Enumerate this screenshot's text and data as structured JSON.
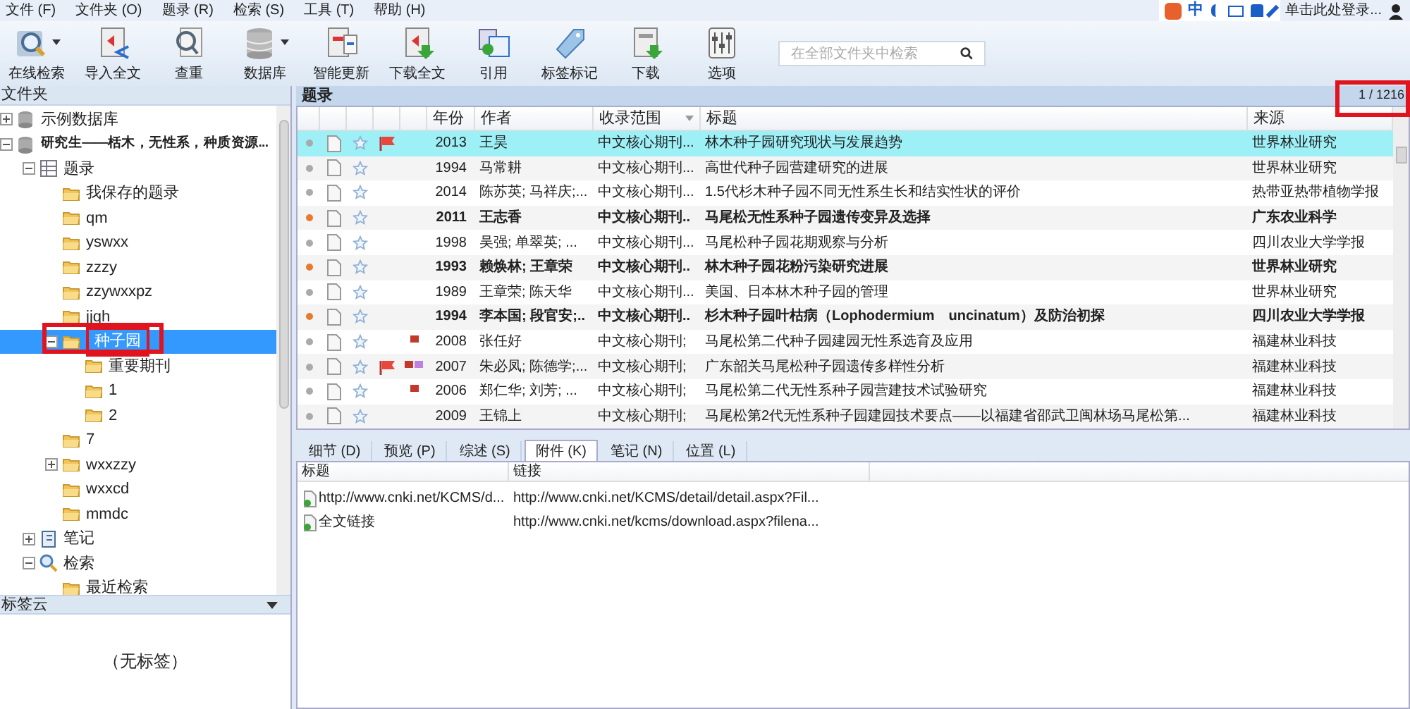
{
  "menu": [
    "文件 (F)",
    "文件夹 (O)",
    "题录 (R)",
    "检索 (S)",
    "工具 (T)",
    "帮助 (H)"
  ],
  "ime": {
    "label": "中",
    "login": "单击此处登录..."
  },
  "toolbar": [
    {
      "kind": "search",
      "label": "在线检索",
      "dropdown": true
    },
    {
      "kind": "import",
      "label": "导入全文",
      "dropdown": false
    },
    {
      "kind": "dedupe",
      "label": "查重",
      "dropdown": false
    },
    {
      "kind": "database",
      "label": "数据库",
      "dropdown": true
    },
    {
      "kind": "update",
      "label": "智能更新",
      "dropdown": false
    },
    {
      "kind": "download-full",
      "label": "下载全文",
      "dropdown": false
    },
    {
      "kind": "cite",
      "label": "引用",
      "dropdown": false
    },
    {
      "kind": "tag",
      "label": "标签标记",
      "dropdown": false
    },
    {
      "kind": "download",
      "label": "下载",
      "dropdown": false
    },
    {
      "kind": "options",
      "label": "选项",
      "dropdown": false
    }
  ],
  "search": {
    "placeholder": "在全部文件夹中检索"
  },
  "folders": {
    "title": "文件夹",
    "tree": [
      {
        "kind": "database",
        "label": "示例数据库",
        "bold": false,
        "expanded": false,
        "selected": false
      },
      {
        "kind": "database",
        "label": "研究生——栝木，无性系，种质资源...",
        "bold": true,
        "expanded": true,
        "selected": false,
        "children": [
          {
            "kind": "records",
            "label": "题录",
            "expanded": true,
            "selected": false,
            "children": [
              {
                "kind": "folder",
                "label": "我保存的题录",
                "selected": false
              },
              {
                "kind": "folder",
                "label": "qm",
                "selected": false
              },
              {
                "kind": "folder",
                "label": "yswxx",
                "selected": false
              },
              {
                "kind": "folder",
                "label": "zzzy",
                "selected": false
              },
              {
                "kind": "folder",
                "label": "zzywxxpz",
                "selected": false
              },
              {
                "kind": "folder",
                "label": "jjqh",
                "selected": false
              },
              {
                "kind": "folder",
                "label": "种子园",
                "expanded": true,
                "selected": true,
                "children": [
                  {
                    "kind": "folder",
                    "label": "重要期刊",
                    "selected": false
                  },
                  {
                    "kind": "folder",
                    "label": "1",
                    "selected": false
                  },
                  {
                    "kind": "folder",
                    "label": "2",
                    "selected": false
                  }
                ]
              },
              {
                "kind": "folder",
                "label": "7",
                "selected": false
              },
              {
                "kind": "folder",
                "label": "wxxzzy",
                "expanded": false,
                "selected": false
              },
              {
                "kind": "folder",
                "label": "wxxcd",
                "selected": false
              },
              {
                "kind": "folder",
                "label": "mmdc",
                "selected": false
              }
            ]
          },
          {
            "kind": "notes",
            "label": "笔记",
            "expanded": false,
            "selected": false
          },
          {
            "kind": "search",
            "label": "检索",
            "expanded": true,
            "selected": false,
            "children": [
              {
                "kind": "folder",
                "label": "最近检索",
                "selected": false
              }
            ]
          }
        ]
      }
    ]
  },
  "tag_cloud": {
    "title": "标签云",
    "empty": "（无标签）"
  },
  "records": {
    "title": "题录",
    "count": "1 / 1216",
    "columns": [
      "年份",
      "作者",
      "收录范围",
      "标题",
      "来源"
    ],
    "rows": [
      {
        "selected": true,
        "unread": false,
        "flagged": true,
        "tags": [],
        "year": "2013",
        "author": "王昊",
        "scope": "中文核心期刊...",
        "title": "林木种子园研究现状与发展趋势",
        "source": "世界林业研究"
      },
      {
        "selected": false,
        "unread": false,
        "flagged": false,
        "tags": [],
        "year": "1994",
        "author": "马常耕",
        "scope": "中文核心期刊...",
        "title": "高世代种子园营建研究的进展",
        "source": "世界林业研究"
      },
      {
        "selected": false,
        "unread": false,
        "flagged": false,
        "tags": [],
        "year": "2014",
        "author": "陈苏英; 马祥庆;...",
        "scope": "中文核心期刊...",
        "title": "1.5代杉木种子园不同无性系生长和结实性状的评价",
        "source": "热带亚热带植物学报"
      },
      {
        "selected": false,
        "unread": true,
        "flagged": false,
        "tags": [],
        "year": "2011",
        "author": "王志香",
        "scope": "中文核心期刊..",
        "title": "马尾松无性系种子园遗传变异及选择",
        "source": "广东农业科学"
      },
      {
        "selected": false,
        "unread": false,
        "flagged": false,
        "tags": [],
        "year": "1998",
        "author": "吴强; 单翠英; ...",
        "scope": "中文核心期刊...",
        "title": "马尾松种子园花期观察与分析",
        "source": "四川农业大学学报"
      },
      {
        "selected": false,
        "unread": true,
        "flagged": false,
        "tags": [],
        "year": "1993",
        "author": "赖焕林; 王章荣",
        "scope": "中文核心期刊..",
        "title": "林木种子园花粉污染研究进展",
        "source": "世界林业研究"
      },
      {
        "selected": false,
        "unread": false,
        "flagged": false,
        "tags": [],
        "year": "1989",
        "author": "王章荣; 陈天华",
        "scope": "中文核心期刊...",
        "title": "美国、日本林木种子园的管理",
        "source": "世界林业研究"
      },
      {
        "selected": false,
        "unread": true,
        "flagged": false,
        "tags": [],
        "year": "1994",
        "author": "李本国; 段官安;..",
        "scope": "中文核心期刊..",
        "title": "杉木种子园叶枯病（Lophodermium　uncinatum）及防治初探",
        "source": "四川农业大学学报"
      },
      {
        "selected": false,
        "unread": false,
        "flagged": false,
        "tags": [
          {
            "color": "#c0392b"
          }
        ],
        "year": "2008",
        "author": "张任好",
        "scope": "中文核心期刊;",
        "title": "马尾松第二代种子园建园无性系选育及应用",
        "source": "福建林业科技"
      },
      {
        "selected": false,
        "unread": false,
        "flagged": true,
        "tags": [
          {
            "color": "#c0392b"
          },
          {
            "color": "#c080e0"
          }
        ],
        "year": "2007",
        "author": "朱必凤; 陈德学;...",
        "scope": "中文核心期刊;",
        "title": "广东韶关马尾松种子园遗传多样性分析",
        "source": "福建林业科技"
      },
      {
        "selected": false,
        "unread": false,
        "flagged": false,
        "tags": [
          {
            "color": "#c0392b"
          }
        ],
        "year": "2006",
        "author": "郑仁华; 刘芳; ...",
        "scope": "中文核心期刊;",
        "title": "马尾松第二代无性系种子园营建技术试验研究",
        "source": "福建林业科技"
      },
      {
        "selected": false,
        "unread": false,
        "flagged": false,
        "tags": [],
        "year": "2009",
        "author": "王锦上",
        "scope": "中文核心期刊;",
        "title": "马尾松第2代无性系种子园建园技术要点——以福建省邵武卫闽林场马尾松第...",
        "source": "福建林业科技"
      }
    ]
  },
  "detail_tabs": [
    {
      "label": "细节 (D)",
      "selected": false
    },
    {
      "label": "预览 (P)",
      "selected": false
    },
    {
      "label": "综述 (S)",
      "selected": false
    },
    {
      "label": "附件 (K)",
      "selected": true
    },
    {
      "label": "笔记 (N)",
      "selected": false
    },
    {
      "label": "位置 (L)",
      "selected": false
    }
  ],
  "attachments": {
    "columns": [
      "标题",
      "链接"
    ],
    "rows": [
      {
        "title": "http://www.cnki.net/KCMS/d...",
        "link": "http://www.cnki.net/KCMS/detail/detail.aspx?Fil..."
      },
      {
        "title": "全文链接",
        "link": "http://www.cnki.net/kcms/download.aspx?filena..."
      }
    ]
  }
}
